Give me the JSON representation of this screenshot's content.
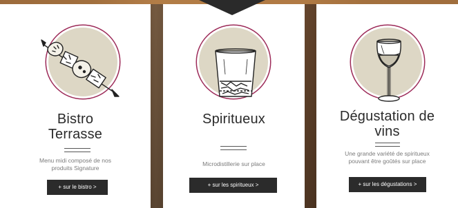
{
  "cards": [
    {
      "title_lines": [
        "Bistro",
        "Terrasse"
      ],
      "description_lines": [
        "Menu midi composé de nos",
        "produits Signature"
      ],
      "button_label": "+ sur le bistro >",
      "icon": "skewer-icon"
    },
    {
      "title_lines": [
        "Spiritueux"
      ],
      "description_lines": [
        "Microdistillerie sur place"
      ],
      "button_label": "+ sur les spiritueux >",
      "icon": "whisky-glass-icon"
    },
    {
      "title_lines": [
        "Dégustation de",
        "vins"
      ],
      "description_lines": [
        "Une grande variété de spiritueux",
        "pouvant être goûtés sur place"
      ],
      "button_label": "+ sur les dégustations >",
      "icon": "wine-glass-icon"
    }
  ],
  "colors": {
    "circle_fill": "#ddd7c5",
    "circle_ring": "#9c2a58",
    "button_bg": "#2b2b2b",
    "title": "#2a2a2a"
  }
}
